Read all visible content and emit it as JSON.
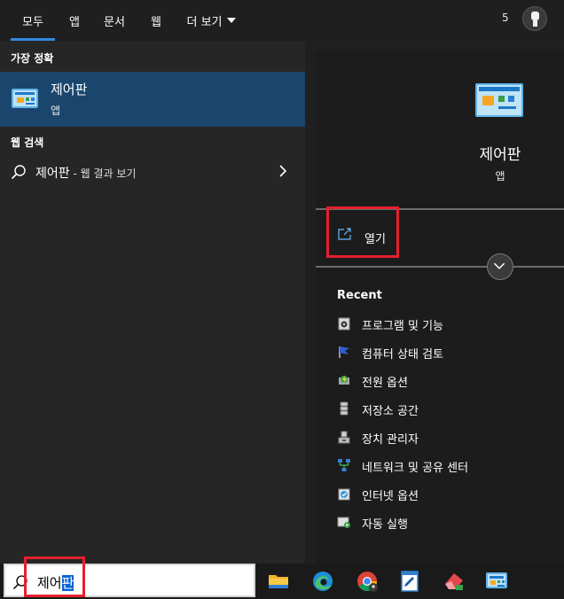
{
  "tabs": [
    {
      "label": "모두",
      "active": true
    },
    {
      "label": "앱",
      "active": false
    },
    {
      "label": "문서",
      "active": false
    },
    {
      "label": "웹",
      "active": false
    },
    {
      "label": "더 보기",
      "active": false
    }
  ],
  "header": {
    "count": "5",
    "avatar_icon": "trophy-icon"
  },
  "best_match": {
    "section_label": "가장 정확",
    "title": "제어판",
    "subtitle": "앱",
    "icon": "control-panel-icon"
  },
  "web_search": {
    "section_label": "웹 검색",
    "term": "제어판",
    "suffix": " - 웹 결과 보기"
  },
  "detail": {
    "title": "제어판",
    "subtitle": "앱",
    "open_label": "열기",
    "recent_label": "Recent",
    "recent_items": [
      {
        "label": "프로그램 및 기능",
        "icon": "programs-features-icon"
      },
      {
        "label": "컴퓨터 상태 검토",
        "icon": "flag-icon"
      },
      {
        "label": "전원 옵션",
        "icon": "power-options-icon"
      },
      {
        "label": "저장소 공간",
        "icon": "storage-spaces-icon"
      },
      {
        "label": "장치 관리자",
        "icon": "device-manager-icon"
      },
      {
        "label": "네트워크 및 공유 센터",
        "icon": "network-center-icon"
      },
      {
        "label": "인터넷 옵션",
        "icon": "internet-options-icon"
      },
      {
        "label": "자동 실행",
        "icon": "autoplay-icon"
      }
    ]
  },
  "search": {
    "query_plain": "제어",
    "query_selected": "판"
  },
  "taskbar_icons": [
    "file-explorer-icon",
    "edge-icon",
    "chrome-icon",
    "notepad-icon",
    "eraser-app-icon",
    "control-panel-icon"
  ],
  "colors": {
    "accent": "#2f8ae0",
    "selection": "#1a466d",
    "highlight_box": "#e5202d"
  }
}
